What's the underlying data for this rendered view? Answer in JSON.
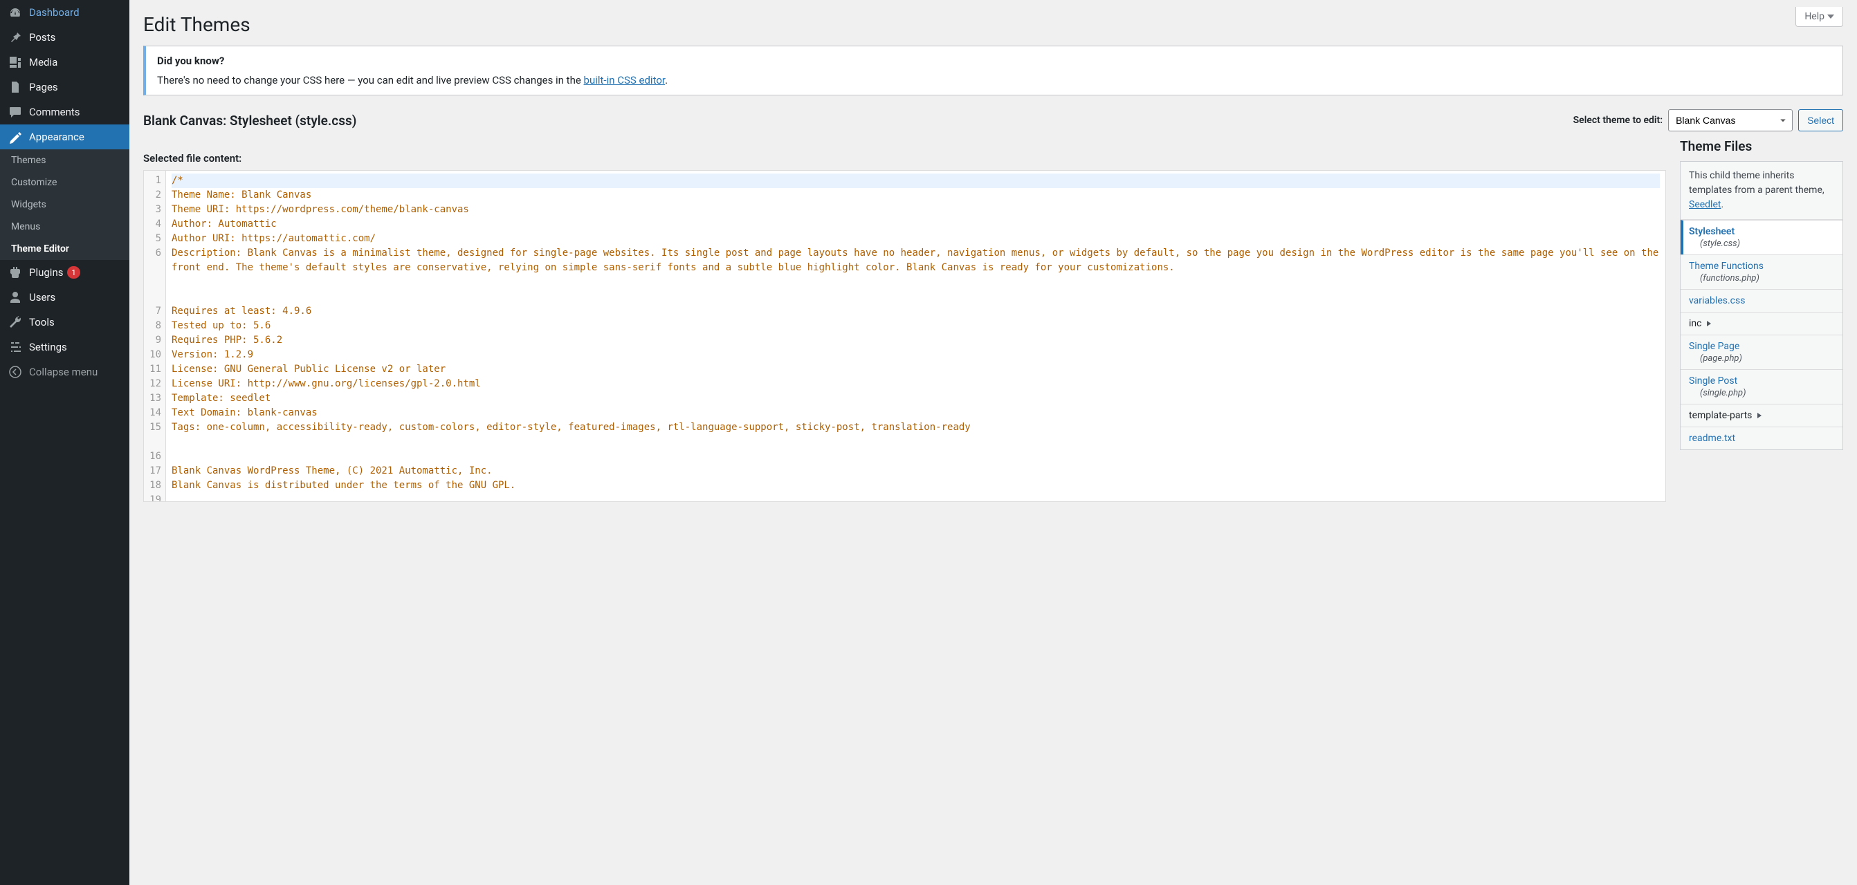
{
  "sidebar": {
    "items": [
      {
        "label": "Dashboard"
      },
      {
        "label": "Posts"
      },
      {
        "label": "Media"
      },
      {
        "label": "Pages"
      },
      {
        "label": "Comments"
      },
      {
        "label": "Appearance",
        "active": true
      }
    ],
    "appearance_sub": [
      {
        "label": "Themes"
      },
      {
        "label": "Customize"
      },
      {
        "label": "Widgets"
      },
      {
        "label": "Menus"
      },
      {
        "label": "Theme Editor",
        "current": true
      }
    ],
    "after": [
      {
        "label": "Plugins",
        "badge": "1"
      },
      {
        "label": "Users"
      },
      {
        "label": "Tools"
      },
      {
        "label": "Settings"
      }
    ],
    "collapse": "Collapse menu"
  },
  "header": {
    "help": "Help",
    "page_title": "Edit Themes"
  },
  "notice": {
    "title": "Did you know?",
    "text_before": "There's no need to change your CSS here — you can edit and live preview CSS changes in the ",
    "link": "built-in CSS editor",
    "text_after": "."
  },
  "file": {
    "heading": "Blank Canvas: Stylesheet (style.css)",
    "select_label": "Select theme to edit:",
    "selected_theme": "Blank Canvas",
    "select_button": "Select",
    "content_label": "Selected file content:"
  },
  "code_lines": [
    "/*",
    "Theme Name: Blank Canvas",
    "Theme URI: https://wordpress.com/theme/blank-canvas",
    "Author: Automattic",
    "Author URI: https://automattic.com/",
    "Description: Blank Canvas is a minimalist theme, designed for single-page websites. Its single post and page layouts have no header, navigation menus, or widgets by default, so the page you design in the WordPress editor is the same page you'll see on the front end. The theme's default styles are conservative, relying on simple sans-serif fonts and a subtle blue highlight color. Blank Canvas is ready for your customizations.",
    "Requires at least: 4.9.6",
    "Tested up to: 5.6",
    "Requires PHP: 5.6.2",
    "Version: 1.2.9",
    "License: GNU General Public License v2 or later",
    "License URI: http://www.gnu.org/licenses/gpl-2.0.html",
    "Template: seedlet",
    "Text Domain: blank-canvas",
    "Tags: one-column, accessibility-ready, custom-colors, editor-style, featured-images, rtl-language-support, sticky-post, translation-ready",
    "",
    "Blank Canvas WordPress Theme, (C) 2021 Automattic, Inc.",
    "Blank Canvas is distributed under the terms of the GNU GPL.",
    ""
  ],
  "files_panel": {
    "title": "Theme Files",
    "inherit_before": "This child theme inherits templates from a parent theme, ",
    "inherit_link": "Seedlet",
    "inherit_after": ".",
    "entries": [
      {
        "label": "Stylesheet",
        "sub": "(style.css)",
        "active": true
      },
      {
        "label": "Theme Functions",
        "sub": "(functions.php)"
      },
      {
        "label": "variables.css"
      },
      {
        "label": "inc",
        "dir": true
      },
      {
        "label": "Single Page",
        "sub": "(page.php)"
      },
      {
        "label": "Single Post",
        "sub": "(single.php)"
      },
      {
        "label": "template-parts",
        "dir": true
      },
      {
        "label": "readme.txt"
      }
    ]
  }
}
